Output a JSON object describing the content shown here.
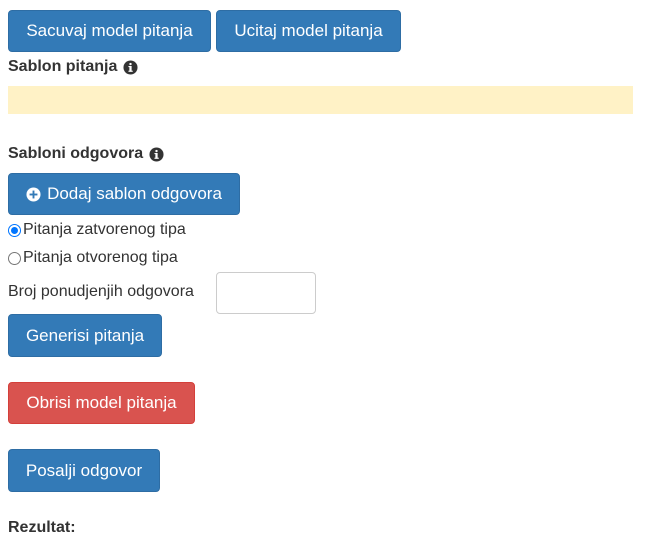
{
  "toolbar": {
    "save_label": "Sacuvaj model pitanja",
    "load_label": "Ucitaj model pitanja"
  },
  "question_template": {
    "heading": "Sablon pitanja",
    "heading_icon": "info-circle-icon"
  },
  "answer_templates": {
    "heading": "Sabloni odgovora",
    "heading_icon": "info-circle-icon",
    "add_label": "Dodaj sablon odgovora",
    "add_icon": "plus-circle-icon"
  },
  "question_type": {
    "options": [
      {
        "label": "Pitanja zatvorenog tipa",
        "checked": true
      },
      {
        "label": "Pitanja otvorenog tipa",
        "checked": false
      }
    ]
  },
  "offered_answers": {
    "label": "Broj ponudjenjih odgovora",
    "value": ""
  },
  "actions": {
    "generate_label": "Generisi pitanja",
    "delete_label": "Obrisi model pitanja",
    "submit_label": "Posalji odgovor"
  },
  "result": {
    "heading": "Rezultat:"
  },
  "colors": {
    "primary": "#337ab7",
    "danger": "#d9534f",
    "banner": "#fff2c6"
  }
}
